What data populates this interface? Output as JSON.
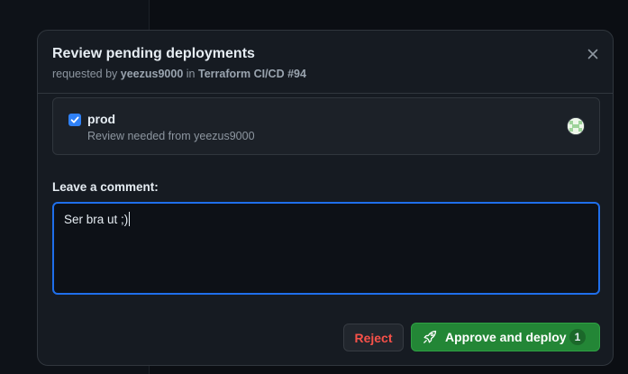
{
  "dialog": {
    "title": "Review pending deployments",
    "subtitle_prefix": "requested by",
    "requester": "yeezus9000",
    "subtitle_in": "in",
    "workflow": "Terraform CI/CD #94",
    "close_icon": "close-icon"
  },
  "environment": {
    "checked": true,
    "name": "prod",
    "review_text": "Review needed from yeezus9000",
    "avatar": "identicon-avatar"
  },
  "comment": {
    "label": "Leave a comment:",
    "value": "Ser bra ut ;)"
  },
  "actions": {
    "reject_label": "Reject",
    "approve_label": "Approve and deploy",
    "approve_icon": "rocket-icon",
    "approve_count": "1"
  },
  "colors": {
    "accent": "#2f81f7",
    "danger": "#f85149",
    "success": "#238636"
  }
}
